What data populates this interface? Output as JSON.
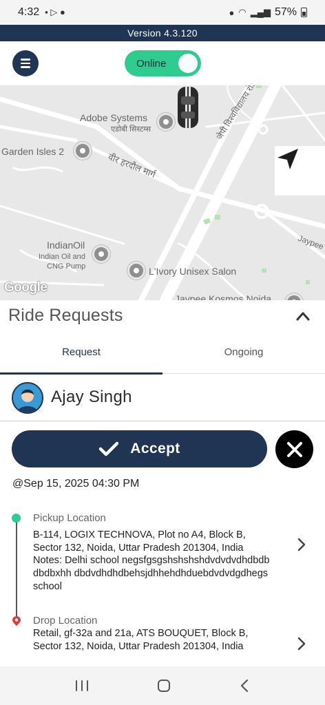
{
  "status_bar": {
    "time": "4:32",
    "battery": "57%"
  },
  "version": "Version 4.3.120",
  "toolbar": {
    "online_label": "Online"
  },
  "map": {
    "labels": {
      "adobe_en": "Adobe Systems",
      "adobe_hi": "एडोबी सिस्टम्स",
      "garden_isles": "Garden Isles 2",
      "road_hi": "वीर हरदौल मार्ग",
      "road_hi_2": "जेपी विश्वविद्यालय रोड",
      "indianoil": "IndianOil",
      "indianoil_sub_1": "Indian Oil and",
      "indianoil_sub_2": "CNG Pump",
      "salon": "L'Ivory Unisex Salon",
      "jaypee": "Jaypee",
      "jaypee_kosmos": "Jaypee Kosmos Noida",
      "google": "Google"
    }
  },
  "ride": {
    "title": "Ride Requests",
    "tabs": [
      {
        "label": "Request"
      },
      {
        "label": "Ongoing"
      }
    ],
    "user_name": "Ajay Singh",
    "accept_label": "Accept",
    "datetime": "@Sep 15, 2025 04:30 PM",
    "pickup": {
      "label": "Pickup Location",
      "address": "B-114, LOGIX TECHNOVA, Plot no A4, Block B, Sector 132, Noida, Uttar Pradesh 201304, India",
      "notes_label": "Notes:",
      "notes": "Delhi school negsfgsgshshshshdvdvdvdhdbdbdbdbxhh dbdvdhdhdbehsjdhhehdhduebdvdvdgdhegs school"
    },
    "drop": {
      "label": "Drop Location",
      "address": "Retail, gf-32a and 21a, ATS BOUQUET, Block B, Sector 132, Noida, Uttar Pradesh 201304, India"
    }
  },
  "colors": {
    "primary": "#1f3553",
    "online_green": "#2ecc8f",
    "reject": "#000000",
    "drop_pin": "#e53935"
  },
  "icons": [
    "menu-icon",
    "navigation-arrow-icon",
    "chevron-up-icon",
    "checkmark-icon",
    "close-icon",
    "chevron-right-icon",
    "recent-apps-icon",
    "home-icon",
    "back-icon"
  ]
}
